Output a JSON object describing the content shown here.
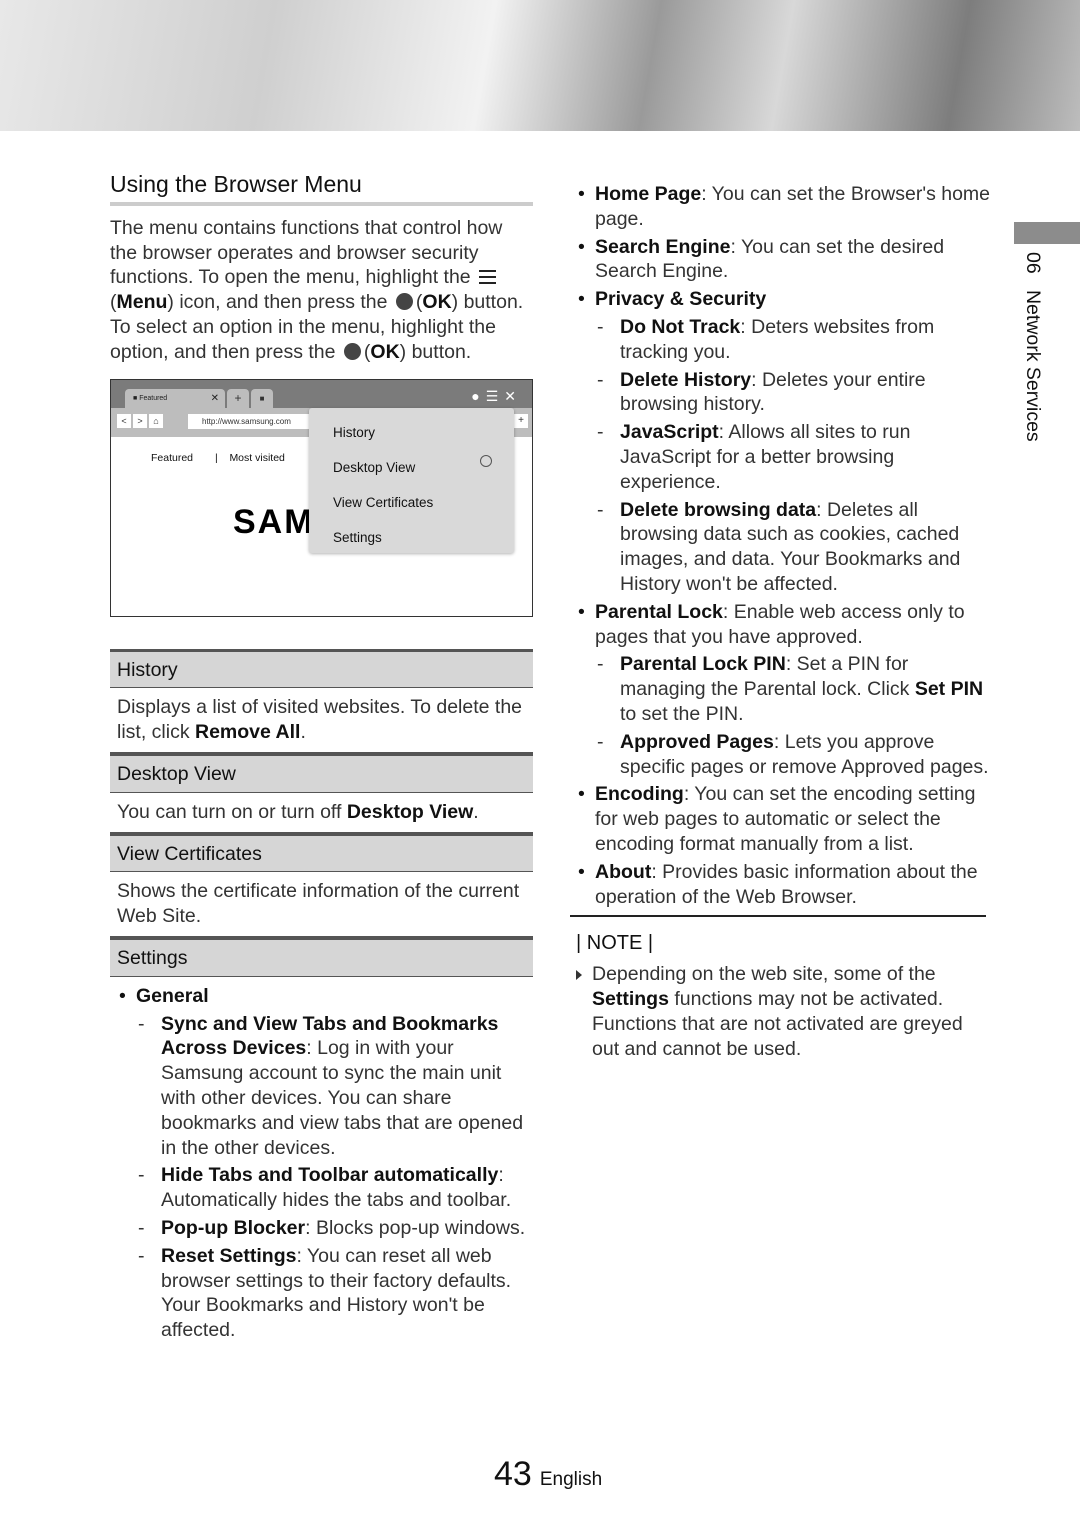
{
  "title": "Using the Browser Menu",
  "intro": {
    "p1": "The menu contains functions that control how the browser operates and browser security functions. To open the menu, highlight the ",
    "menu_label": "Menu",
    "p2": " icon, and then press the ",
    "ok_label": "OK",
    "p3": " button. To select an option in the menu, highlight the option, and then press the ",
    "p4": " button.",
    "icons": [
      "menu-icon",
      "ok-button-icon"
    ]
  },
  "screenshot": {
    "tab_label": "Featured",
    "url": "http://www.samsung.com",
    "subtabs": [
      "Featured",
      "Most visited"
    ],
    "logo": "SAM",
    "menu_items": [
      "History",
      "Desktop View",
      "View Certificates",
      "Settings"
    ]
  },
  "sections": [
    {
      "heading": "History",
      "pre": "Displays a list of visited websites. To delete the list, click ",
      "bold": "Remove All",
      "post": "."
    },
    {
      "heading": "Desktop View",
      "pre": "You can turn on or turn off ",
      "bold": "Desktop View",
      "post": "."
    },
    {
      "heading": "View Certificates",
      "pre": "Shows the certificate information of the current Web Site.",
      "bold": "",
      "post": ""
    },
    {
      "heading": "Settings"
    }
  ],
  "general": {
    "label": "General",
    "items": [
      {
        "term": "Sync and View Tabs and Bookmarks Across Devices",
        "desc": ": Log in with your Samsung account to sync the main unit with other devices. You can share bookmarks and view tabs that are opened in the other devices."
      },
      {
        "term": "Hide Tabs and Toolbar automatically",
        "desc": ": Automatically hides the tabs and toolbar."
      },
      {
        "term": "Pop-up Blocker",
        "desc": ": Blocks pop-up windows."
      },
      {
        "term": "Reset Settings",
        "desc": ": You can reset all web browser settings to their factory defaults. Your Bookmarks and History won't be affected."
      }
    ]
  },
  "right": {
    "home": {
      "term": "Home Page",
      "desc": ": You can set the Browser's home page."
    },
    "search": {
      "term": "Search Engine",
      "desc": ": You can set the desired Search Engine."
    },
    "privacy": {
      "term": "Privacy & Security",
      "items": [
        {
          "term": "Do Not Track",
          "desc": ": Deters websites from tracking you."
        },
        {
          "term": "Delete History",
          "desc": ": Deletes your entire browsing history."
        },
        {
          "term": "JavaScript",
          "desc": ": Allows all sites to run JavaScript for a better browsing experience."
        },
        {
          "term": "Delete browsing data",
          "desc": ": Deletes all browsing data such as cookies, cached images, and data. Your Bookmarks and History won't be affected."
        }
      ]
    },
    "parental": {
      "term": "Parental Lock",
      "desc": ": Enable web access only to pages that you have approved.",
      "items": [
        {
          "term": "Parental Lock PIN",
          "desc": ": Set a PIN for managing the Parental lock. Click ",
          "bold2": "Set PIN",
          "desc2": " to set the PIN."
        },
        {
          "term": "Approved Pages",
          "desc": ": Lets you approve specific pages or remove Approved pages."
        }
      ]
    },
    "encoding": {
      "term": "Encoding",
      "desc": ": You can set the encoding setting for web pages to automatic or select the encoding format manually from a list."
    },
    "about": {
      "term": "About",
      "desc": ": Provides basic information about the operation of the Web Browser."
    }
  },
  "note": {
    "heading": "| NOTE |",
    "pre": "Depending on the web site, some of the ",
    "bold": "Settings",
    "post": " functions may not be activated. Functions that are not activated are greyed out and cannot be used."
  },
  "side_tab": {
    "chapter": "06",
    "title": "Network Services"
  },
  "footer": {
    "page": "43",
    "language": "English"
  }
}
